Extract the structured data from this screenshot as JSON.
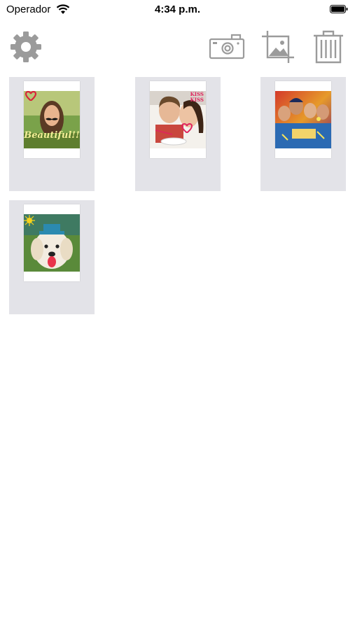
{
  "status_bar": {
    "carrier": "Operador",
    "time": "4:34 p.m.",
    "wifi_icon": "wifi-icon",
    "battery_icon": "battery-icon"
  },
  "toolbar": {
    "settings_icon": "gear-icon",
    "camera_icon": "camera-icon",
    "crop_image_icon": "crop-image-icon",
    "delete_icon": "trash-icon",
    "icon_color": "#9b9b9b"
  },
  "gallery": {
    "tile_color": "#e3e3e8",
    "items": [
      {
        "subject": "girl with hearts and mustache sticker",
        "caption": "Beautiful!!"
      },
      {
        "subject": "couple kissing with heart stickers",
        "caption": "KISS KISS"
      },
      {
        "subject": "group of friends with party stickers",
        "caption": ""
      },
      {
        "subject": "white puppy with hat and tongue stickers",
        "caption": ""
      }
    ]
  }
}
